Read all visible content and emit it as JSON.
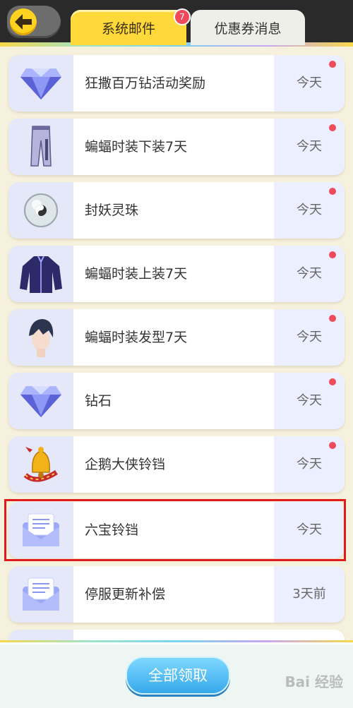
{
  "tabs": [
    {
      "label": "系统邮件",
      "badge": "7",
      "active": true
    },
    {
      "label": "优惠券消息",
      "active": false
    }
  ],
  "mails": [
    {
      "subject": "狂撒百万钻活动奖励",
      "date": "今天",
      "unread": true,
      "icon": "diamond-icon"
    },
    {
      "subject": "蝙蝠时装下装7天",
      "date": "今天",
      "unread": true,
      "icon": "pants-icon"
    },
    {
      "subject": "封妖灵珠",
      "date": "今天",
      "unread": true,
      "icon": "orb-icon"
    },
    {
      "subject": "蝙蝠时装上装7天",
      "date": "今天",
      "unread": true,
      "icon": "jacket-icon"
    },
    {
      "subject": "蝙蝠时装发型7天",
      "date": "今天",
      "unread": true,
      "icon": "hair-icon"
    },
    {
      "subject": "钻石",
      "date": "今天",
      "unread": true,
      "icon": "diamond-icon"
    },
    {
      "subject": "企鹅大侠铃铛",
      "date": "今天",
      "unread": true,
      "icon": "bell-icon"
    },
    {
      "subject": "六宝铃铛",
      "date": "今天",
      "unread": false,
      "icon": "envelope-icon"
    },
    {
      "subject": "停服更新补偿",
      "date": "3天前",
      "unread": false,
      "icon": "envelope-icon"
    }
  ],
  "footer": {
    "claim_all_label": "全部领取"
  },
  "watermark": "Bai 经验"
}
